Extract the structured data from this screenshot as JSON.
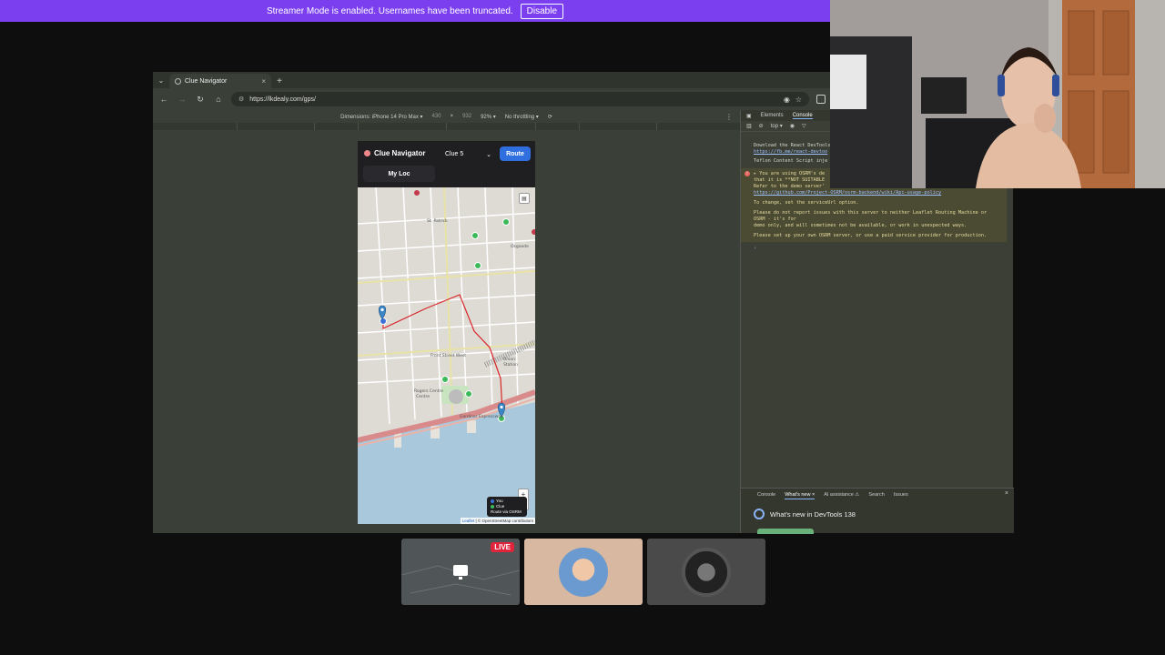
{
  "banner": {
    "message": "Streamer Mode is enabled. Usernames have been truncated.",
    "disable_label": "Disable"
  },
  "browser": {
    "tab_title": "Clue Navigator",
    "tab_close": "×",
    "new_tab": "+",
    "url": "https://lkdealy.com/gps/",
    "device": {
      "dimensions_label": "Dimensions: iPhone 14 Pro Max ▾",
      "width": "430",
      "x": "×",
      "height": "932",
      "zoom": "92% ▾",
      "throttling": "No throttling ▾"
    }
  },
  "app": {
    "title": "Clue Navigator",
    "clue_select": "Clue 5",
    "route_label": "Route",
    "myloc_label": "My Loc",
    "legend": {
      "you": "You",
      "clue": "Clue",
      "route": "Route via OSRM"
    },
    "zoom_in": "+",
    "zoom_out": "−",
    "attribution_leaflet": "Leaflet",
    "attribution_rest": " | © OpenStreetMap contributors",
    "map_labels": {
      "st_patrick": "St. Patrick",
      "osgoode": "Osgoode",
      "union": "Union",
      "station": "Station",
      "front_street": "Front Street West",
      "rogers": "Rogers Centre",
      "centre": "Centre",
      "gardiner": "Gardiner Expressway"
    }
  },
  "devtools": {
    "tabs": [
      "Elements",
      "Console"
    ],
    "filter_context": "top ▾",
    "console_lines": {
      "react_devtools": "Download the React DevTools",
      "react_link": "https://fb.me/react-devtoo",
      "teflon": "Teflon Content Script inje",
      "osrm_1": "▸ You are using OSRM's de",
      "osrm_2": "that it is **NOT SUITABLE",
      "osrm_3": "Refer to the demo server'",
      "osrm_link": "https://github.com/Project-OSRM/osrm-backend/wiki/Api-usage-policy",
      "service": "To change, set the serviceUrl option.",
      "report_1": "Please do not report issues with this server to neither Leaflet Routing Machine or",
      "report_2": "OSRM - it's for",
      "report_3": "demo only, and will sometimes not be available, or work in unexpected ways.",
      "setup": "Please set up your own OSRM server, or use a paid service provider for production.",
      "prompt": "›"
    },
    "drawer_tabs": [
      "Console",
      "What's new ×",
      "AI assistance ⚠",
      "Search",
      "Issues"
    ],
    "drawer_close": "×",
    "whats_new_title": "What's new in DevTools 138"
  },
  "stream": {
    "live_label": "LIVE"
  },
  "colors": {
    "route": "#d9262a",
    "clue": "#3cba5a",
    "you": "#3b6fd8",
    "accent": "#7b3ff0"
  }
}
